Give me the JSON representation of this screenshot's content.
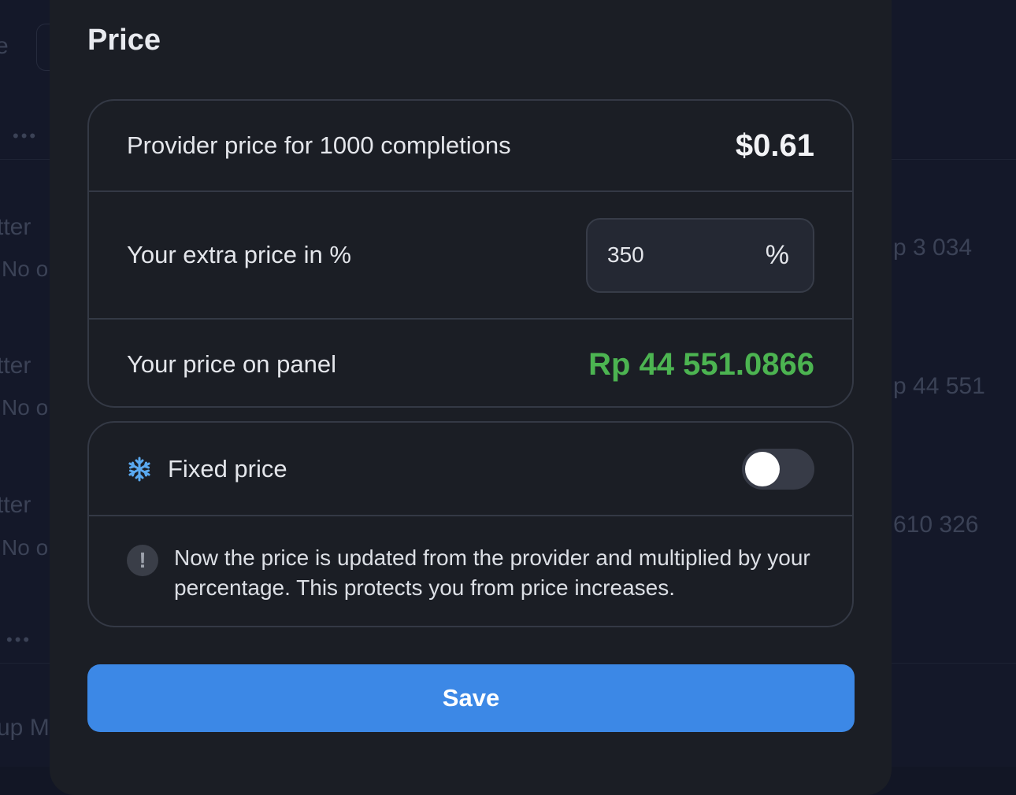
{
  "background": {
    "fragments": [
      "e",
      "tter",
      "No o",
      "tter",
      "No o",
      "tter",
      "No o",
      "up M",
      "p 3 034",
      "p 44 551",
      "610 326"
    ],
    "dots": "•••"
  },
  "modal": {
    "title": "Price",
    "provider_price": {
      "label": "Provider price for 1000 completions",
      "value": "$0.61"
    },
    "extra_price": {
      "label": "Your extra price in %",
      "value": "350",
      "unit": "%"
    },
    "panel_price": {
      "label": "Your price on panel",
      "value": "Rp 44 551.0866"
    },
    "fixed_price": {
      "icon": "snowflake-icon",
      "label": "Fixed price",
      "enabled": false
    },
    "info": {
      "icon": "exclamation-icon",
      "text": "Now the price is updated from the provider and multiplied by your percentage. This protects you from price increases."
    },
    "save_label": "Save"
  },
  "colors": {
    "accent": "#3c88e6",
    "positive": "#4cb451",
    "snowflake": "#5aa9f0"
  }
}
